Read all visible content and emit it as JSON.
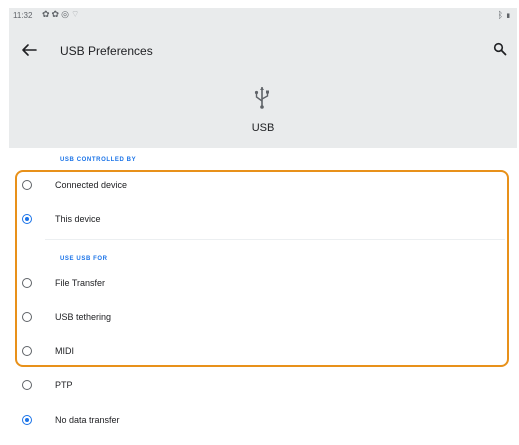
{
  "status_bar": {
    "time": "11:32",
    "left_icons": [
      "gear-icon",
      "gear-icon",
      "at-icon",
      "wifi-icon"
    ],
    "right_icons": [
      "bluetooth-icon",
      "battery-icon"
    ]
  },
  "app_bar": {
    "title": "USB Preferences",
    "back_icon": "arrow-left-icon",
    "search_icon": "search-icon"
  },
  "header": {
    "icon": "usb-icon",
    "label": "USB"
  },
  "sections": {
    "controlled_by": {
      "heading": "USB CONTROLLED BY",
      "options": [
        {
          "label": "Connected device",
          "selected": false
        },
        {
          "label": "This device",
          "selected": true
        }
      ]
    },
    "use_for": {
      "heading": "USE USB FOR",
      "options": [
        {
          "label": "File Transfer",
          "selected": false
        },
        {
          "label": "USB tethering",
          "selected": false
        },
        {
          "label": "MIDI",
          "selected": false
        },
        {
          "label": "PTP",
          "selected": false
        },
        {
          "label": "No data transfer",
          "selected": true
        }
      ]
    }
  },
  "colors": {
    "accent": "#1a73e8",
    "highlight_border": "#e8911a",
    "header_bg": "#e9ebec"
  }
}
